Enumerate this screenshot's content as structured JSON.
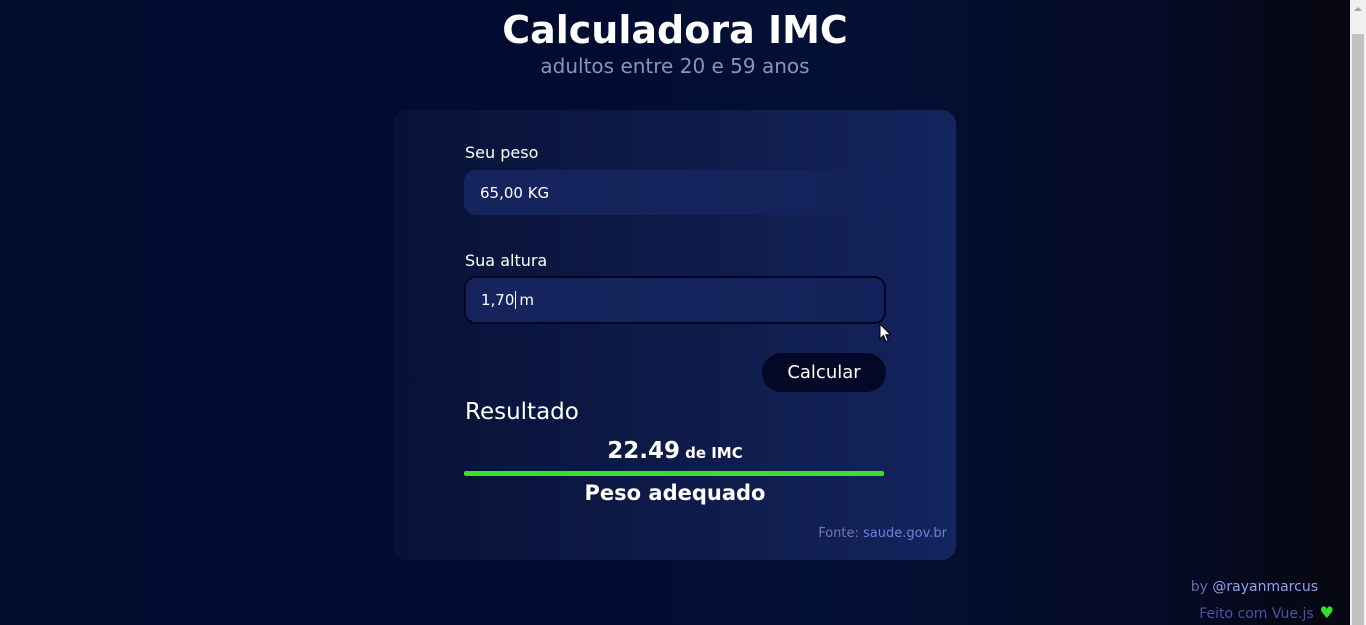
{
  "header": {
    "title": "Calculadora IMC",
    "subtitle": "adultos entre 20 e 59 anos"
  },
  "form": {
    "weight_label": "Seu peso",
    "weight_value": "65,00 KG",
    "height_label": "Sua altura",
    "height_value": "1,70",
    "height_unit": "m",
    "calculate_button": "Calcular"
  },
  "result": {
    "heading": "Resultado",
    "imc_value": "22.49",
    "imc_unit": "de IMC",
    "status": "Peso adequado",
    "bar_fill_percent": 100,
    "bar_color": "#3ae12b"
  },
  "source": {
    "label": "Fonte:",
    "link": "saude.gov.br"
  },
  "footer": {
    "by_label": "by",
    "author": "@rayanmarcus",
    "made_with": "Feito com Vue.js",
    "heart_icon": "heart-icon",
    "heart_color": "#35e02a"
  }
}
